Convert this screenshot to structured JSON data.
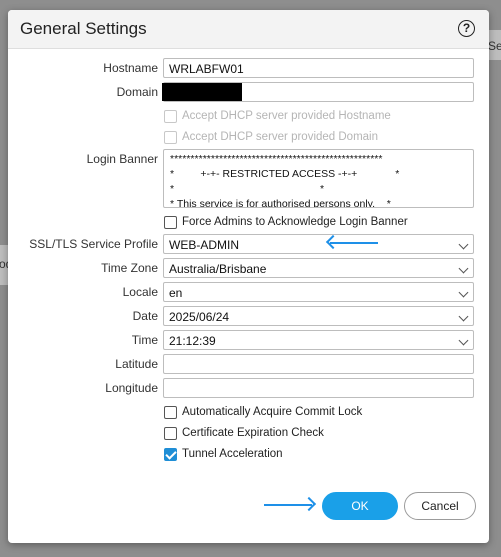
{
  "background": {
    "fragment_left": "od",
    "fragment_right": "Se"
  },
  "dialog": {
    "title": "General Settings",
    "help_glyph": "?"
  },
  "fields": {
    "hostname": {
      "label": "Hostname",
      "value": "WRLABFW01"
    },
    "domain": {
      "label": "Domain",
      "value": ""
    },
    "login_banner": {
      "label": "Login Banner",
      "lines": [
        "****************************************************",
        "*         +-+- RESTRICTED ACCESS -+-+             *",
        "*                                                  *",
        "* This service is for authorised persons only.    *",
        "*                                                  *"
      ]
    },
    "ssl_tls_profile": {
      "label": "SSL/TLS Service Profile",
      "value": "WEB-ADMIN"
    },
    "time_zone": {
      "label": "Time Zone",
      "value": "Australia/Brisbane"
    },
    "locale": {
      "label": "Locale",
      "value": "en"
    },
    "date": {
      "label": "Date",
      "value": "2025/06/24"
    },
    "time": {
      "label": "Time",
      "value": "21:12:39"
    },
    "latitude": {
      "label": "Latitude",
      "value": ""
    },
    "longitude": {
      "label": "Longitude",
      "value": ""
    }
  },
  "checkboxes": {
    "dhcp_hostname": {
      "label": "Accept DHCP server provided Hostname",
      "checked": false,
      "disabled": true
    },
    "dhcp_domain": {
      "label": "Accept DHCP server provided Domain",
      "checked": false,
      "disabled": true
    },
    "force_banner": {
      "label": "Force Admins to Acknowledge Login Banner",
      "checked": false
    },
    "commit_lock": {
      "label": "Automatically Acquire Commit Lock",
      "checked": false
    },
    "cert_expiry": {
      "label": "Certificate Expiration Check",
      "checked": false
    },
    "tunnel_accel": {
      "label": "Tunnel Acceleration",
      "checked": true
    }
  },
  "buttons": {
    "ok": "OK",
    "cancel": "Cancel"
  },
  "colors": {
    "accent": "#1aa0e8",
    "annotation_arrow": "#1e90e8",
    "checkbox_checked": "#1f8ed6"
  },
  "icons": {
    "help": "help-circle-icon",
    "dropdown": "chevron-down-icon"
  }
}
